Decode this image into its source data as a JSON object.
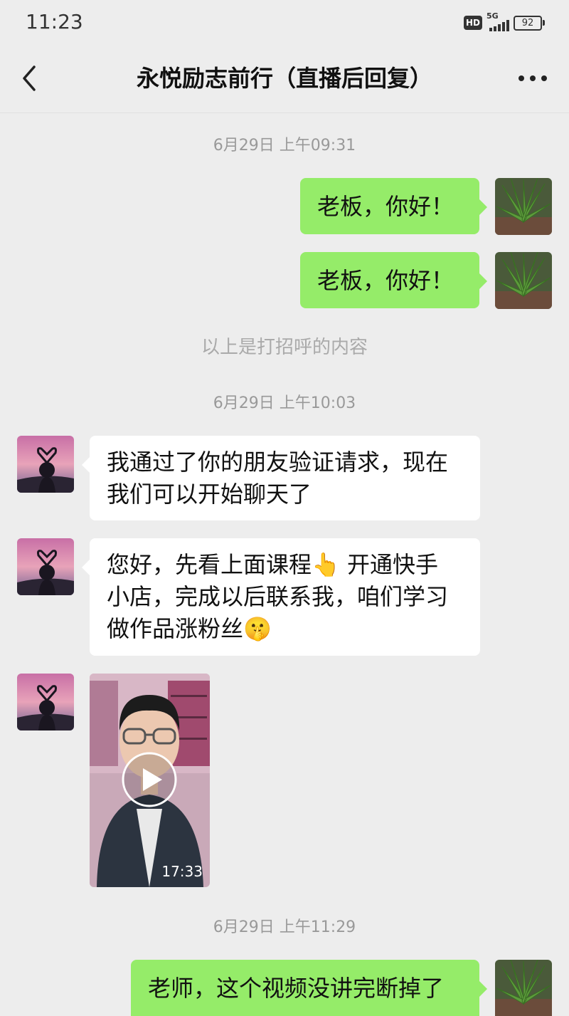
{
  "status_bar": {
    "time": "11:23",
    "hd_badge": "HD",
    "network": "5G",
    "battery": "92"
  },
  "nav": {
    "title": "永悦励志前行（直播后回复）"
  },
  "messages": [
    {
      "type": "timestamp",
      "text": "6月29日 上午09:31"
    },
    {
      "type": "sent",
      "text": "老板，你好！"
    },
    {
      "type": "sent",
      "text": "老板，你好！"
    },
    {
      "type": "system",
      "text": "以上是打招呼的内容"
    },
    {
      "type": "timestamp",
      "text": "6月29日 上午10:03"
    },
    {
      "type": "received",
      "lines": [
        "我通过了你的朋友验证请求，现在",
        "我们可以开始聊天了"
      ]
    },
    {
      "type": "received",
      "lines": [
        "您好，先看上面课程👆 开通快手",
        "小店，完成以后联系我，咱们学习",
        "做作品涨粉丝🤫"
      ]
    },
    {
      "type": "video",
      "duration": "17:33"
    },
    {
      "type": "timestamp",
      "text": "6月29日 上午11:29"
    },
    {
      "type": "sent",
      "text": "老师，这个视频没讲完断掉了"
    }
  ],
  "icons": {
    "back": "chevron-left-icon",
    "more": "more-dots-icon",
    "play": "play-icon",
    "my_avatar": "aloe-plant-avatar",
    "contact_avatar": "sunset-heart-hands-avatar"
  },
  "colors": {
    "sent_bubble": "#95ec69",
    "received_bubble": "#ffffff",
    "background": "#ededed"
  }
}
